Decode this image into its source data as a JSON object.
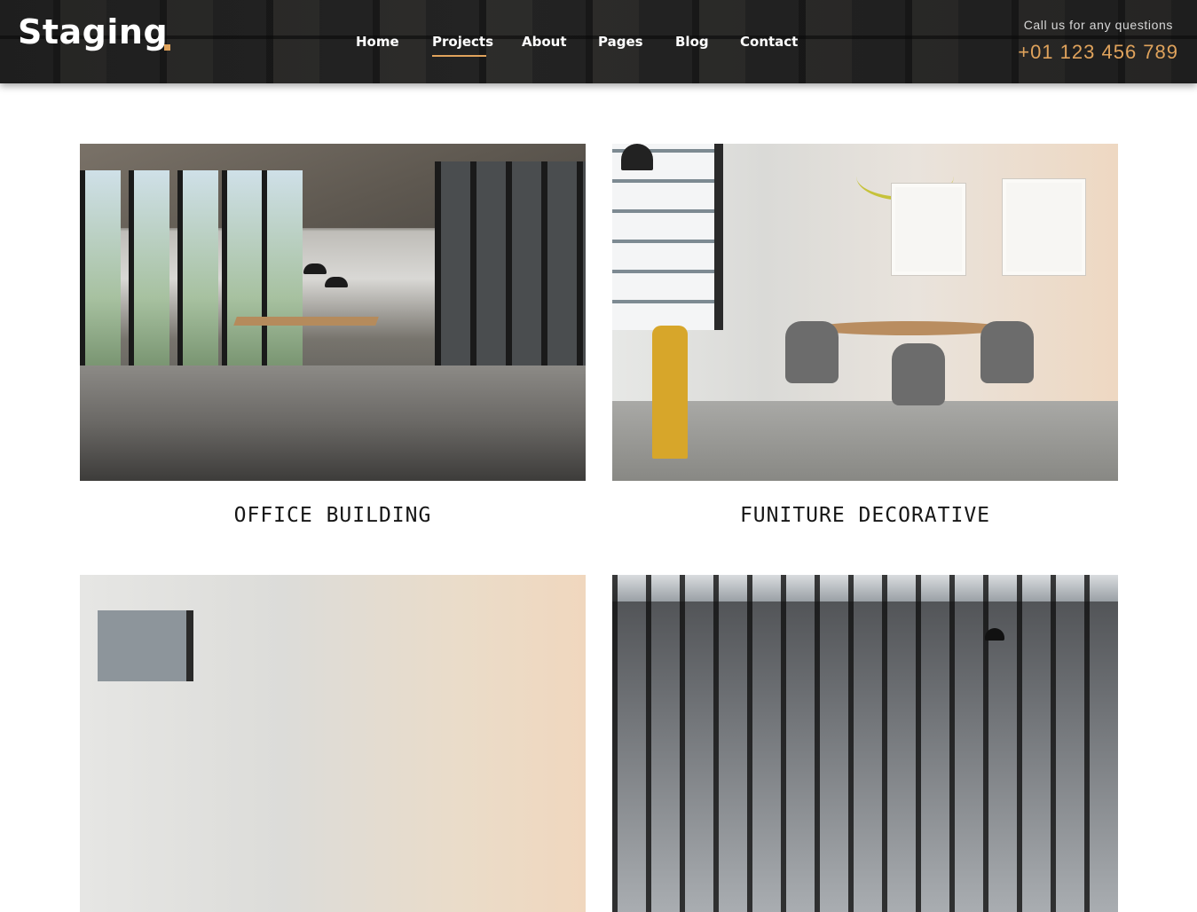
{
  "header": {
    "logo_text": "Staging",
    "nav": [
      {
        "label": "Home"
      },
      {
        "label": "Projects",
        "active": true
      },
      {
        "label": "About"
      },
      {
        "label": "Pages"
      },
      {
        "label": "Blog"
      },
      {
        "label": "Contact"
      }
    ],
    "call_label": "Call us for any questions",
    "phone": "+01 123 456 789",
    "accent_color": "#e0a35c"
  },
  "projects": [
    {
      "title": "OFFICE BUILDING",
      "image_alt": "office-interior-image"
    },
    {
      "title": "FUNITURE DECORATIVE",
      "image_alt": "dining-room-image"
    },
    {
      "title": "",
      "image_alt": "dining-room-image-2"
    },
    {
      "title": "",
      "image_alt": "office-corridor-image"
    }
  ]
}
